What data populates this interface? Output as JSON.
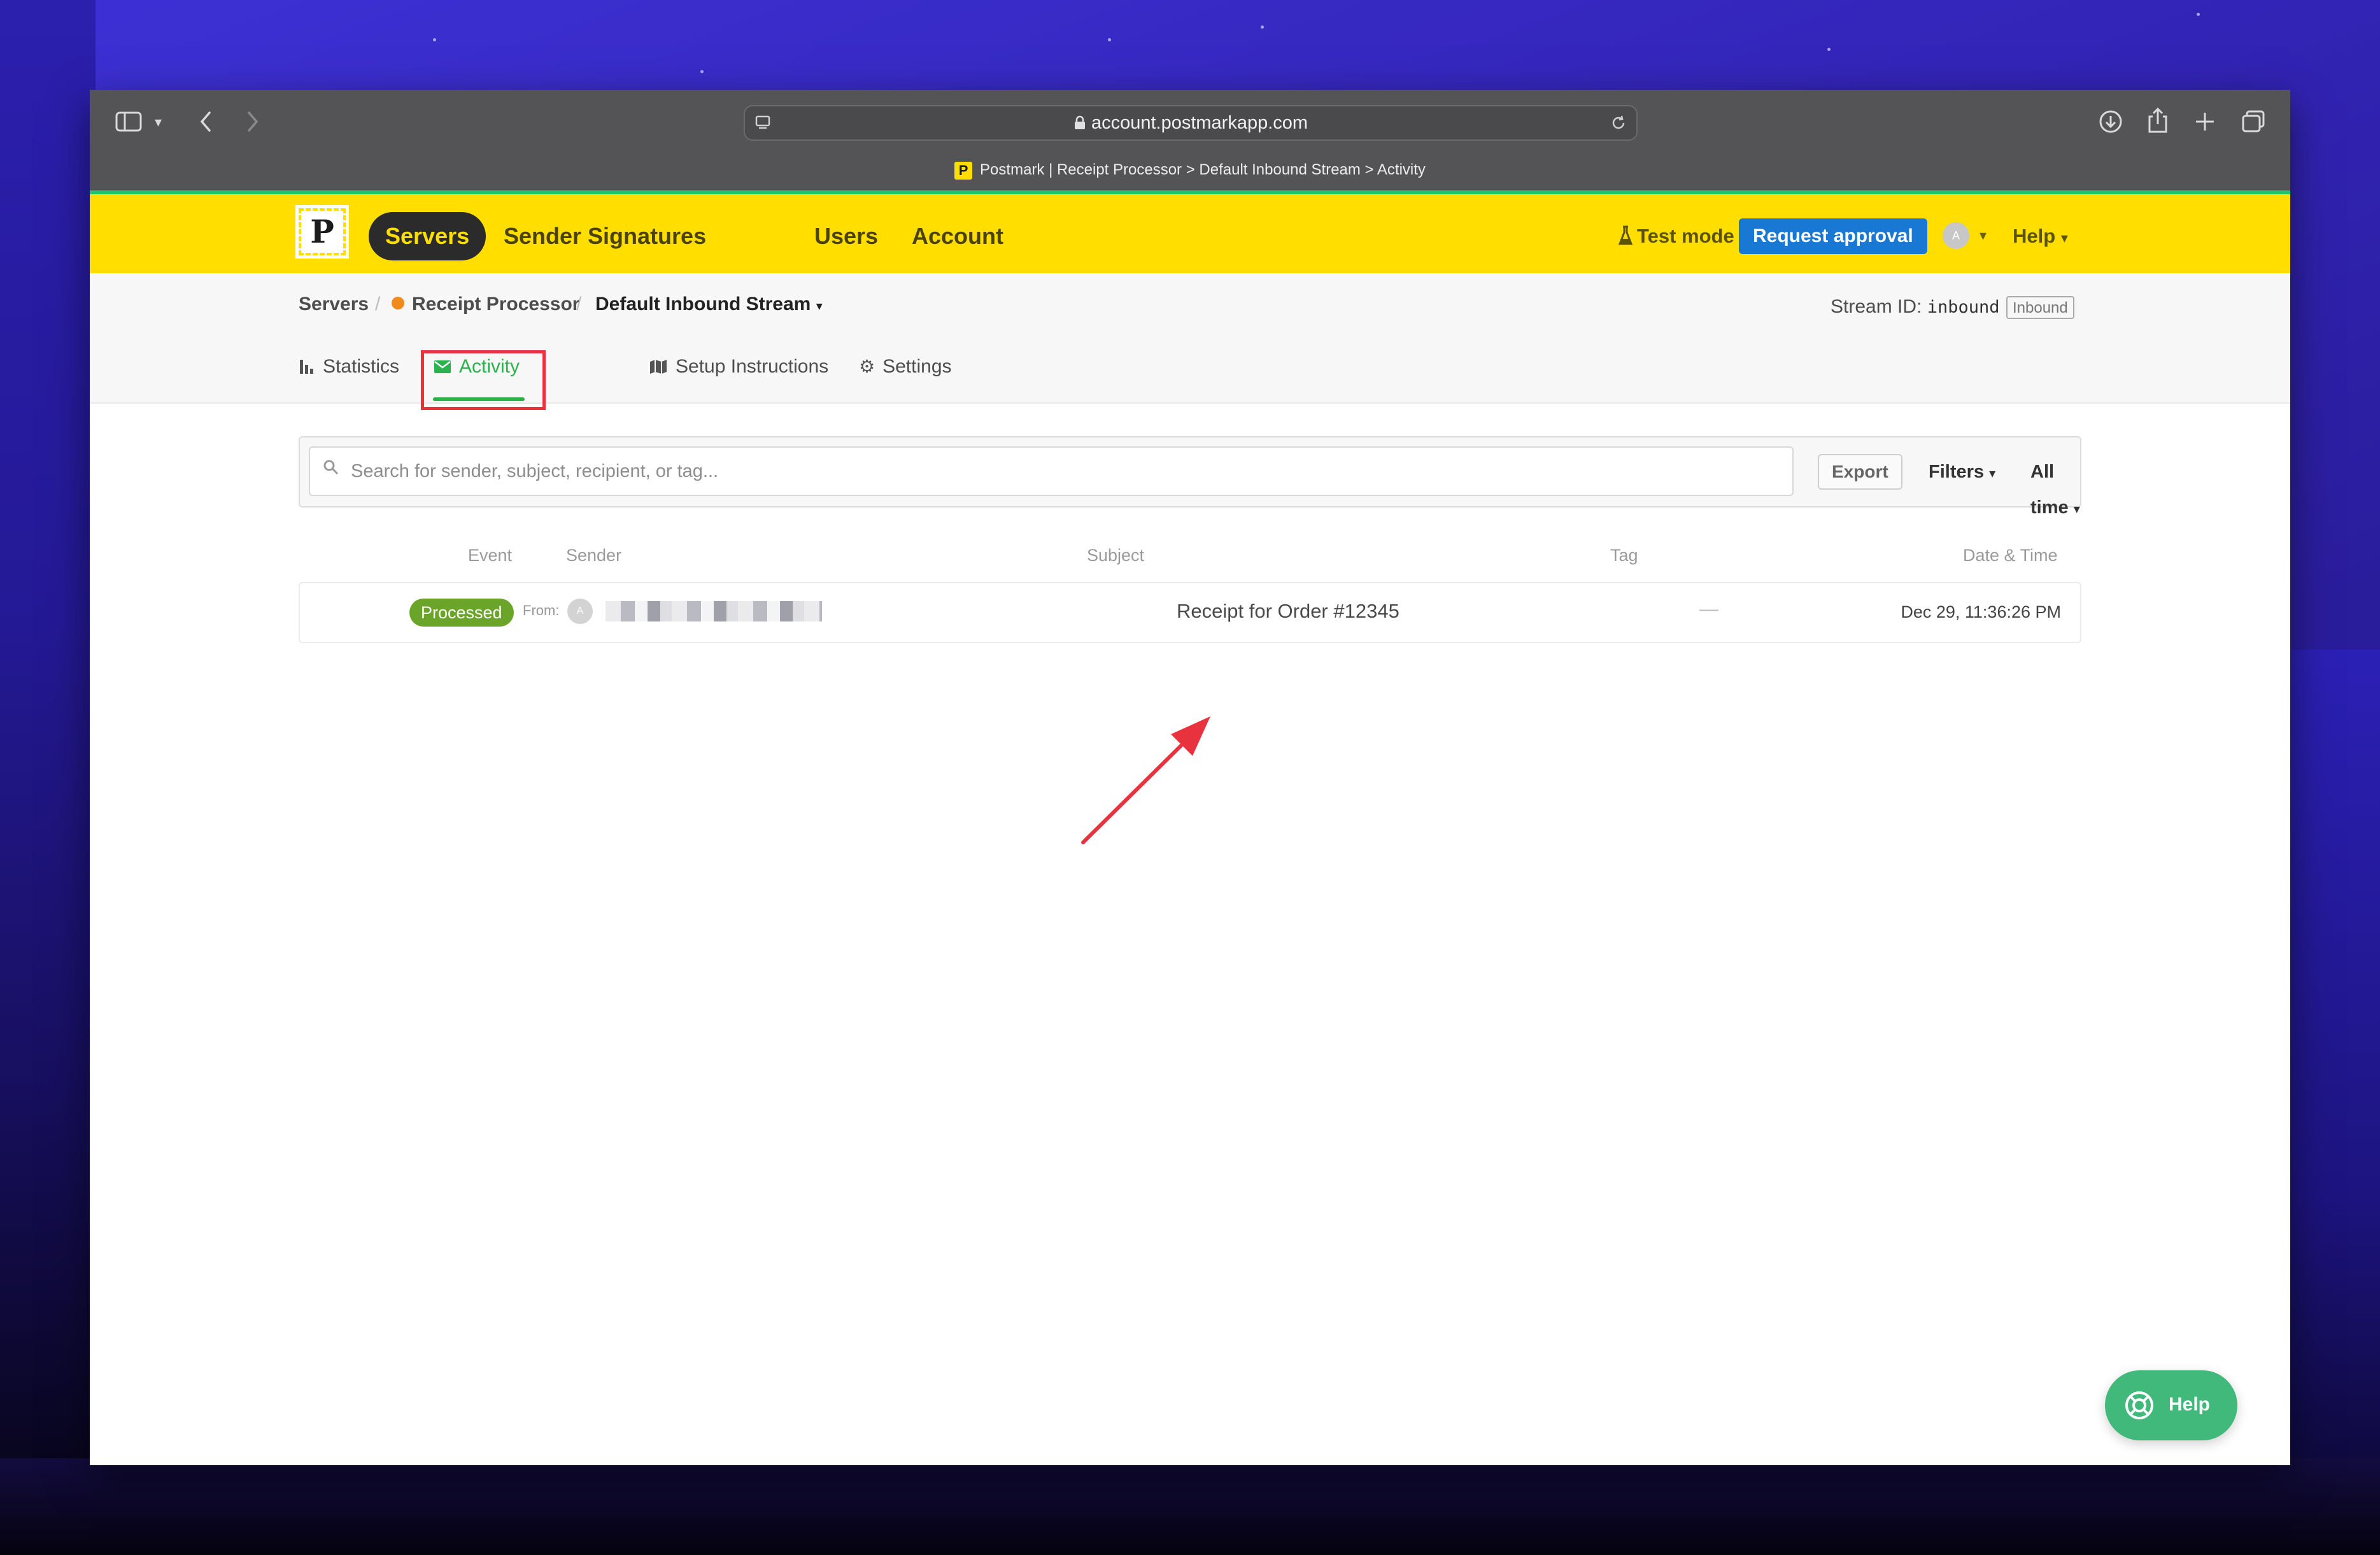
{
  "browser": {
    "url": "account.postmarkapp.com",
    "tab_title": "Postmark | Receipt Processor > Default Inbound Stream > Activity",
    "favicon_letter": "P"
  },
  "topnav": {
    "logo_letter": "P",
    "items": [
      "Servers",
      "Sender Signatures",
      "Users",
      "Account"
    ],
    "active": "Servers",
    "test_mode": "Test mode",
    "request_approval": "Request approval",
    "avatar_letter": "A",
    "help": "Help"
  },
  "breadcrumb": {
    "servers": "Servers",
    "server": "Receipt Processor",
    "stream": "Default Inbound Stream"
  },
  "stream_info": {
    "label": "Stream ID:",
    "id": "inbound",
    "type_badge": "Inbound"
  },
  "tabs": {
    "statistics": "Statistics",
    "activity": "Activity",
    "setup": "Setup Instructions",
    "settings": "Settings"
  },
  "toolbar": {
    "search_placeholder": "Search for sender, subject, recipient, or tag...",
    "export": "Export",
    "filters": "Filters",
    "range": "All time"
  },
  "table": {
    "headers": {
      "event": "Event",
      "sender": "Sender",
      "subject": "Subject",
      "tag": "Tag",
      "datetime": "Date & Time"
    },
    "rows": [
      {
        "event": "Processed",
        "from_label": "From:",
        "sender_avatar": "A",
        "subject": "Receipt for Order #12345",
        "tag": "—",
        "datetime": "Dec 29, 11:36:26 PM"
      }
    ]
  },
  "help_button": "Help",
  "colors": {
    "brand_yellow": "#ffde00",
    "active_green": "#2bb24c",
    "processed_green": "#6aa52a",
    "primary_blue": "#1978d4",
    "annotation_red": "#e8333f",
    "help_green": "#41b97a"
  }
}
